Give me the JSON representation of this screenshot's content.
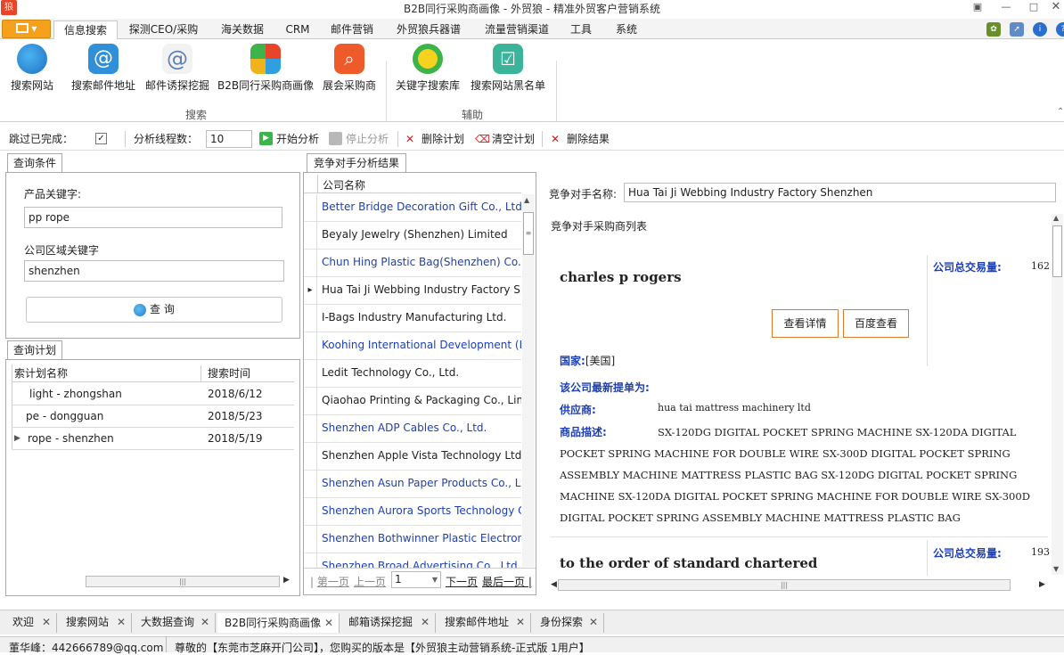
{
  "window": {
    "app_icon_text": "狼",
    "title": "B2B同行采购商画像 - 外贸狼 - 精准外贸客户营销系统"
  },
  "ribbon_tabs": [
    "信息搜索",
    "探测CEO/采购",
    "海关数据",
    "CRM",
    "邮件营销",
    "外贸狼兵器谱",
    "流量营销渠道",
    "工具",
    "系统"
  ],
  "ribbon": {
    "search_group": {
      "label": "搜索",
      "buttons": [
        "搜索网站",
        "搜索邮件地址",
        "邮件诱探挖掘",
        "B2B同行采购商画像",
        "展会采购商"
      ]
    },
    "aux_group": {
      "label": "辅助",
      "buttons": [
        "关键字搜索库",
        "搜索网站黑名单"
      ]
    }
  },
  "toolbar": {
    "skip_done_label": "跳过已完成：",
    "skip_done_checked": true,
    "threads_label": "分析线程数：",
    "threads_value": "10",
    "start": "开始分析",
    "stop": "停止分析",
    "delete_plan": "删除计划",
    "clear_plan": "清空计划",
    "delete_result": "删除结果"
  },
  "query": {
    "tab": "查询条件",
    "product_label": "产品关键字:",
    "product_value": "pp rope",
    "region_label": "公司区域关键字",
    "region_value": "shenzhen",
    "button": "查 询"
  },
  "plan": {
    "tab": "查询计划",
    "columns": [
      "索计划名称",
      "搜索时间"
    ],
    "rows": [
      {
        "name": "light - zhongshan",
        "time": "2018/6/12"
      },
      {
        "name": "pe - dongguan",
        "time": "2018/5/23"
      },
      {
        "name": "rope - shenzhen",
        "time": "2018/5/19"
      }
    ]
  },
  "results": {
    "tab": "竞争对手分析结果",
    "column": "公司名称",
    "rows": [
      {
        "name": "Better Bridge Decoration Gift Co., Ltd.",
        "color": "#1c3fb5"
      },
      {
        "name": "Beyaly Jewelry (Shenzhen) Limited",
        "color": "#222222"
      },
      {
        "name": "Chun Hing Plastic Bag(Shenzhen) Co., Ltd.",
        "color": "#1c3fb5"
      },
      {
        "name": "Hua Tai Ji Webbing Industry Factory Shenzhen",
        "color": "#222222"
      },
      {
        "name": "I-Bags Industry Manufacturing Ltd.",
        "color": "#222222"
      },
      {
        "name": "Koohing International Development (HK)",
        "color": "#1c3fb5"
      },
      {
        "name": "Ledit Technology Co., Ltd.",
        "color": "#222222"
      },
      {
        "name": "Qiaohao Printing & Packaging Co., Limited",
        "color": "#222222"
      },
      {
        "name": "Shenzhen ADP Cables Co., Ltd.",
        "color": "#1c3fb5"
      },
      {
        "name": "Shenzhen Apple Vista Technology Ltd.",
        "color": "#222222"
      },
      {
        "name": "Shenzhen Asun Paper Products Co., Ltd.",
        "color": "#1c3fb5"
      },
      {
        "name": "Shenzhen Aurora Sports Technology Co.",
        "color": "#1c3fb5"
      },
      {
        "name": "Shenzhen Bothwinner Plastic Electronic Factory",
        "color": "#1c3fb5"
      },
      {
        "name": "Shenzhen Broad Advertising Co., Ltd.",
        "color": "#1c3fb5"
      }
    ],
    "pager": {
      "first": "第一页",
      "prev": "上一页",
      "page": "1",
      "next": "下一页",
      "last": "最后一页"
    }
  },
  "detail": {
    "competitor_label": "竞争对手名称:",
    "competitor_value": "Hua Tai Ji Webbing Industry Factory Shenzhen",
    "list_title": "竞争对手采购商列表",
    "buyers": [
      {
        "name": "charles p rogers",
        "volume_label": "公司总交易量:",
        "volume": "162",
        "btn_detail": "查看详情",
        "btn_baidu": "百度查看",
        "country_label": "国家:",
        "country": "[美国]",
        "latest_label": "该公司最新提单为:",
        "supplier_label": "供应商:",
        "supplier": "hua tai mattress machinery ltd",
        "desc_label": "商品描述:",
        "desc": "SX-120DG DIGITAL POCKET SPRING MACHINE SX-120DA DIGITAL POCKET SPRING MACHINE FOR DOUBLE WIRE SX-300D DIGITAL POCKET SPRING ASSEMBLY MACHINE MATTRESS PLASTIC BAG SX-120DG DIGITAL POCKET SPRING MACHINE SX-120DA DIGITAL POCKET SPRING MACHINE FOR DOUBLE WIRE SX-300D DIGITAL POCKET SPRING ASSEMBLY MACHINE MATTRESS PLASTIC BAG"
      },
      {
        "name": "to the order of standard chartered",
        "volume_label": "公司总交易量:",
        "volume": "193"
      }
    ]
  },
  "bottom_tabs": [
    "欢迎",
    "搜索网站",
    "大数据查询",
    "B2B同行采购商画像",
    "邮箱诱探挖掘",
    "搜索邮件地址",
    "身份探索"
  ],
  "status": {
    "left": "董华峰：442666789@qq.com",
    "right": "尊敬的【东莞市芝麻开门公司】，您购买的版本是【外贸狼主动营销系统-正式版 1用户】"
  }
}
